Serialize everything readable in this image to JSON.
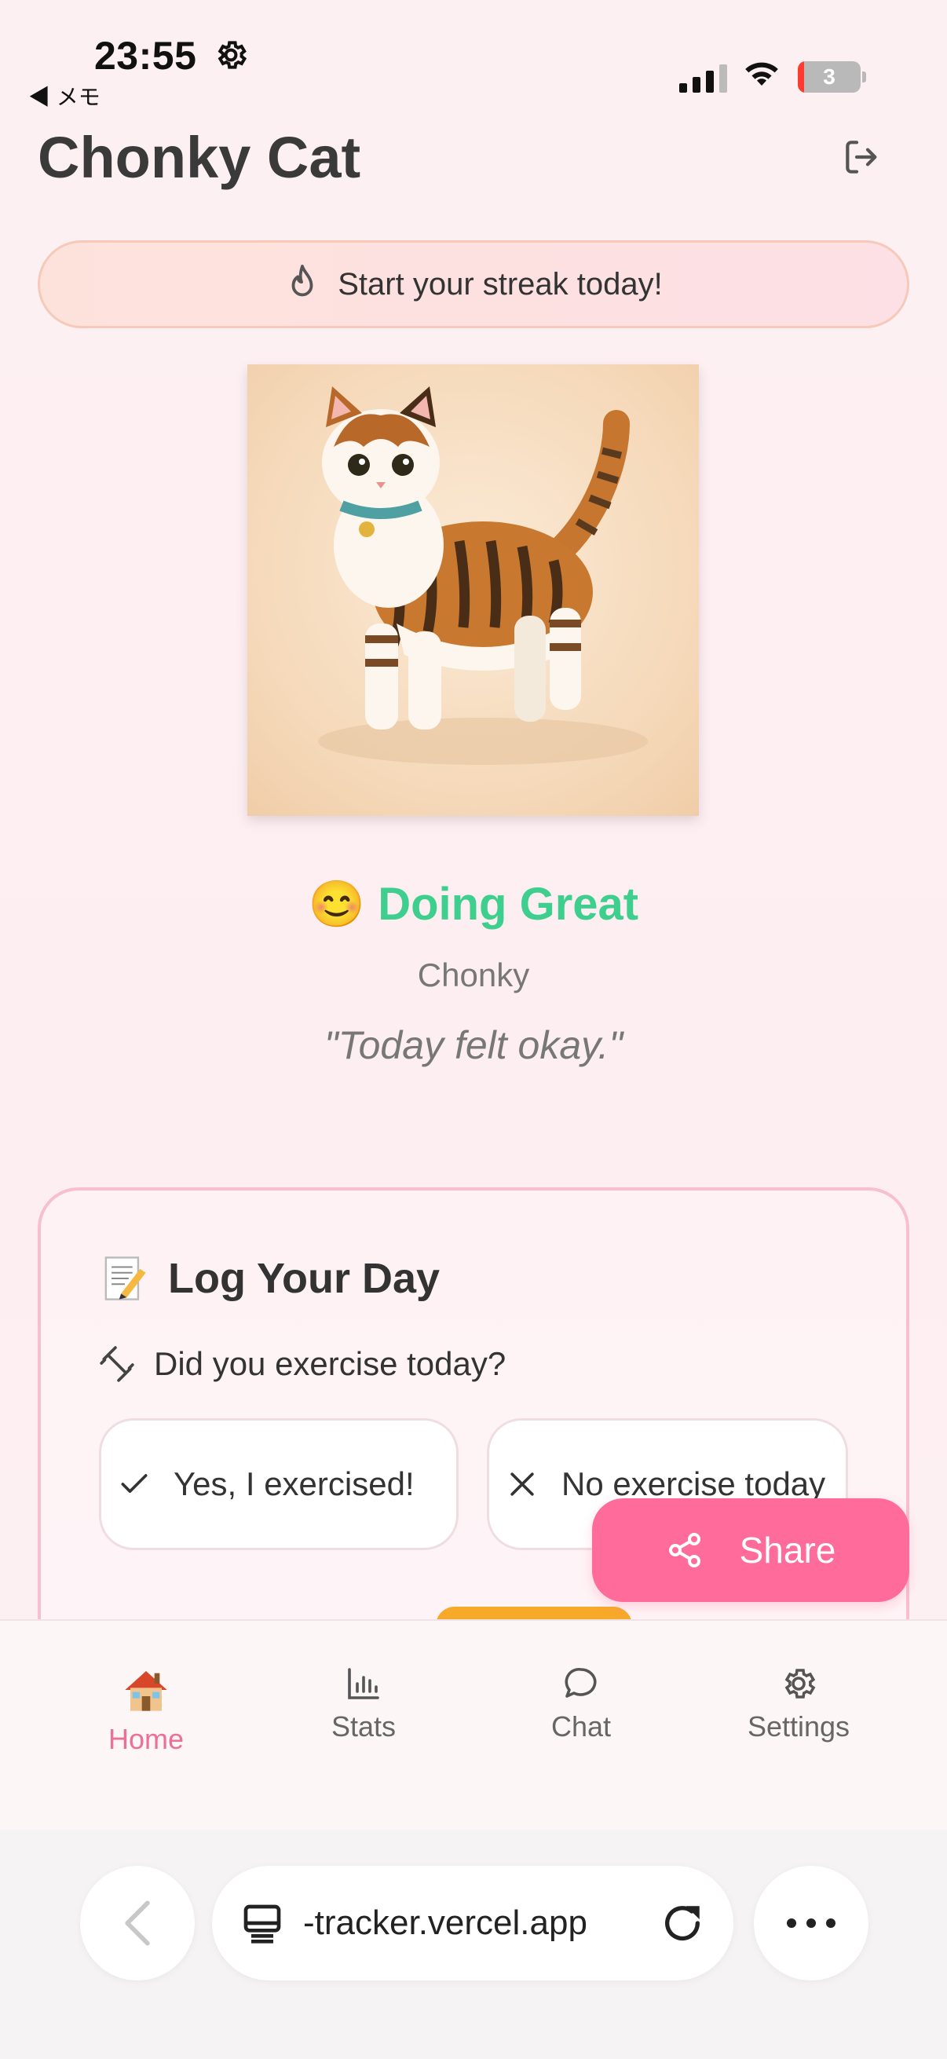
{
  "status_bar": {
    "time": "23:55",
    "back_app": "◀ メモ",
    "battery_level": "3"
  },
  "header": {
    "title": "Chonky Cat",
    "logout_icon": "logout-icon"
  },
  "streak": {
    "icon": "flame-icon",
    "text": "Start your streak today!"
  },
  "pet": {
    "mood_emoji": "😊",
    "mood_label": "Doing Great",
    "mood_color": "#3ecf8e",
    "name": "Chonky",
    "quote": "\"Today felt okay.\""
  },
  "log_card": {
    "title_icon": "memo-icon",
    "title": "Log Your Day",
    "question_icon": "dumbbell-icon",
    "question": "Did you exercise today?",
    "option_yes": "Yes, I exercised!",
    "option_no": "No exercise today"
  },
  "share": {
    "icon": "share-icon",
    "label": "Share",
    "color": "#ff6b9a"
  },
  "nav": {
    "items": [
      {
        "label": "Home",
        "icon": "house-icon",
        "active": true
      },
      {
        "label": "Stats",
        "icon": "bar-chart-icon",
        "active": false
      },
      {
        "label": "Chat",
        "icon": "chat-bubble-icon",
        "active": false
      },
      {
        "label": "Settings",
        "icon": "gear-icon",
        "active": false
      }
    ],
    "active_color": "#ec6f98"
  },
  "browser": {
    "url": "-tracker.vercel.app",
    "page_icon": "tab-view-icon",
    "reload_icon": "reload-icon",
    "back_icon": "chevron-left-icon",
    "more_icon": "more-dots-icon"
  }
}
